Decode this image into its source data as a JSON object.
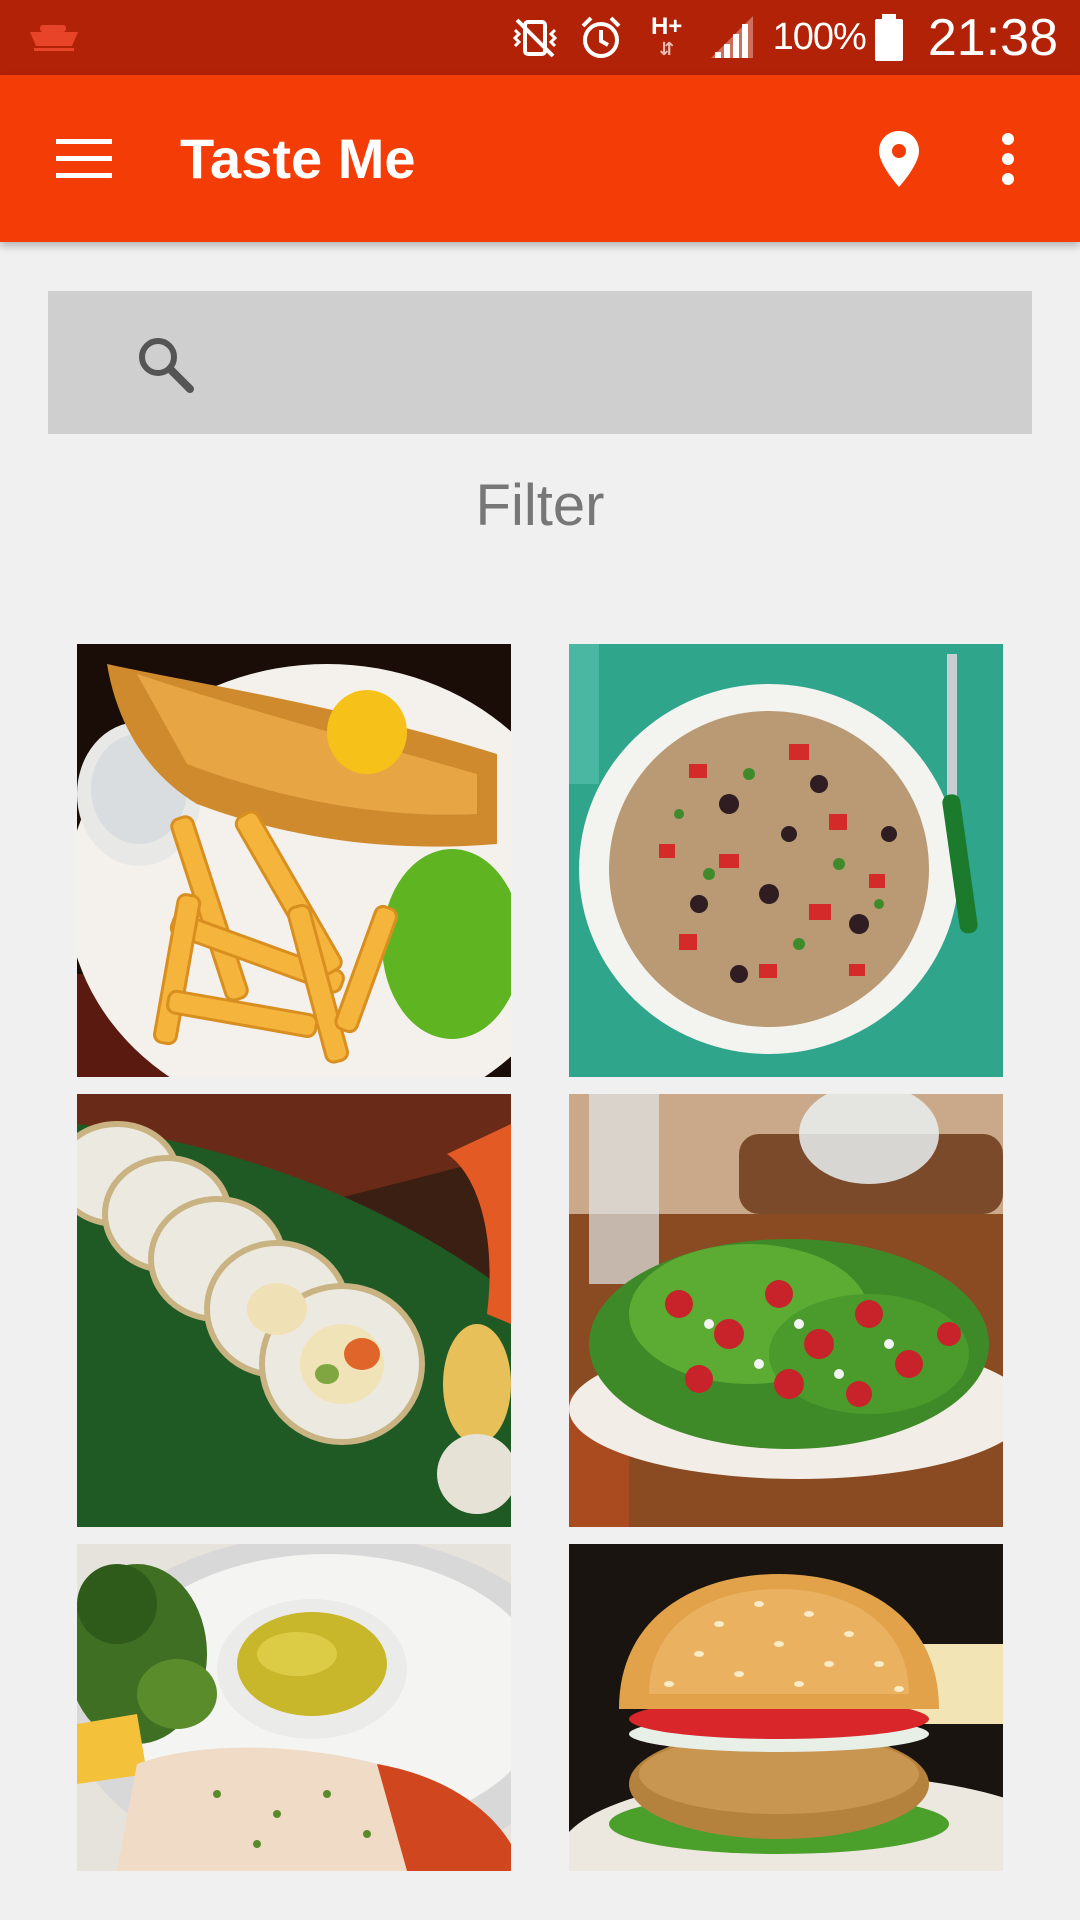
{
  "status_bar": {
    "battery_percent": "100%",
    "time": "21:38",
    "network": "H+",
    "background_color": "#b22206"
  },
  "app_bar": {
    "title": "Taste Me",
    "background_color": "#f43c06",
    "icons": [
      "menu-icon",
      "location-pin-icon",
      "overflow-menu-icon"
    ]
  },
  "search": {
    "placeholder": "",
    "value": ""
  },
  "filter": {
    "label": "Filter"
  },
  "food_grid": {
    "items": [
      {
        "name": "fish-and-chips"
      },
      {
        "name": "rice-salad"
      },
      {
        "name": "sushi-rolls"
      },
      {
        "name": "green-salad"
      },
      {
        "name": "lobster"
      },
      {
        "name": "burger"
      }
    ]
  }
}
